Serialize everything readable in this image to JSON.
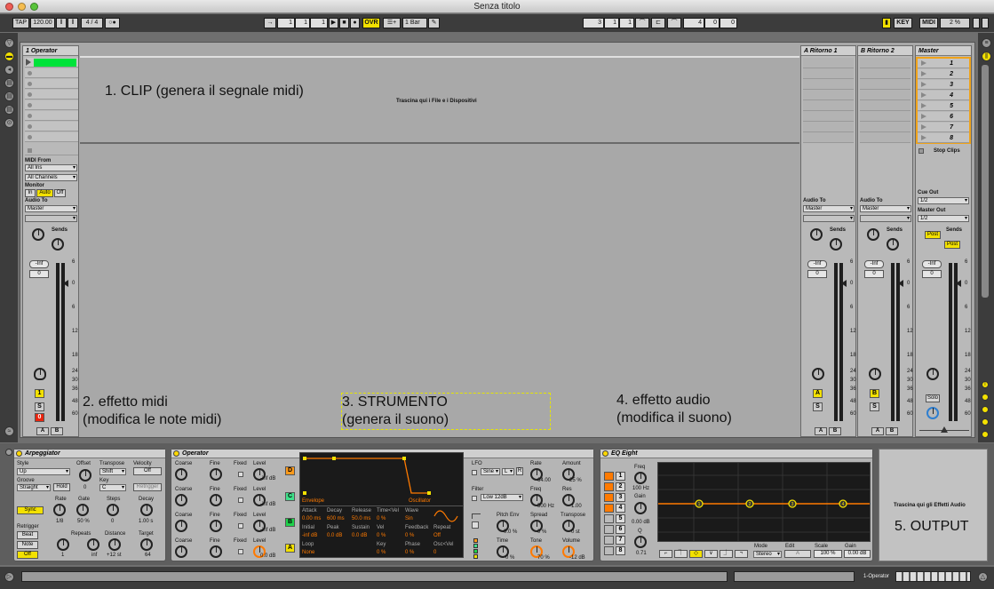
{
  "window": {
    "title": "Senza titolo"
  },
  "transport": {
    "tap": "TAP",
    "tempo": "120.00",
    "sig": "4 / 4",
    "pos_a": "1",
    "pos_b": "1",
    "pos_c": "1",
    "ovr": "OVR",
    "quant": "1 Bar",
    "loop_a": "3",
    "loop_b": "1",
    "loop_c": "1",
    "len_a": "4",
    "len_b": "0",
    "len_c": "0",
    "key": "KEY",
    "midi": "MIDI",
    "cpu": "2 %"
  },
  "tracks": {
    "midi_track": "1 Operator",
    "return_a": "A Ritorno 1",
    "return_b": "B Ritorno 2",
    "master": "Master"
  },
  "session": {
    "drop_hint": "Trascina qui i File e i Dispositivi",
    "scenes": [
      "1",
      "2",
      "3",
      "4",
      "5",
      "6",
      "7",
      "8"
    ],
    "stop_clips": "Stop Clips"
  },
  "io": {
    "midi_from": "MIDI From",
    "all_ins": "All Ins",
    "all_channels": "All Channels",
    "monitor": "Monitor",
    "mon_in": "In",
    "mon_auto": "Auto",
    "mon_off": "Off",
    "audio_to": "Audio To",
    "master": "Master",
    "cue_out": "Cue Out",
    "cue_val": "1/2",
    "master_out": "Master Out",
    "master_out_val": "1/2"
  },
  "mixer": {
    "sends": "Sends",
    "send_a": "A",
    "send_b": "B",
    "vol_inf": "-Inf",
    "vol_zero": "0",
    "post": "Post",
    "track_num": "1",
    "solo": "S",
    "arm": "0",
    "ab_a": "A",
    "ab_b": "B",
    "return_a_btn": "A",
    "return_b_btn": "B",
    "solo_label": "Solo",
    "scale_ticks": [
      "6",
      "0",
      "6",
      "12",
      "18",
      "24",
      "30",
      "36",
      "48",
      "60"
    ]
  },
  "annotations": {
    "clip": "1. CLIP (genera il segnale midi)",
    "midi_fx_1": "2. effetto midi",
    "midi_fx_2": "(modifica le note midi)",
    "instrument_1": "3. STRUMENTO",
    "instrument_2": "(genera il suono)",
    "audio_fx_1": "4. effetto audio",
    "audio_fx_2": "(modifica il suono)",
    "output": "5. OUTPUT"
  },
  "arpeggiator": {
    "title": "Arpeggiator",
    "style": "Style",
    "style_val": "Up",
    "offset": "Offset",
    "offset_val": "0",
    "transpose": "Transpose",
    "transpose_val": "Shift",
    "velocity": "Velocity",
    "vel_off": "Off",
    "groove": "Groove",
    "groove_val": "Straight",
    "hold": "Hold",
    "key": "Key",
    "key_val": "C",
    "retrigger_btn": "Retrigger",
    "sync": "Sync",
    "rate": "Rate",
    "rate_val": "1/8",
    "gate": "Gate",
    "gate_val": "50 %",
    "steps": "Steps",
    "steps_val": "0",
    "decay": "Decay",
    "decay_val": "1.00 s",
    "retrigger": "Retrigger",
    "beat": "Beat",
    "note": "Note",
    "off": "Off",
    "repeats": "Repeats",
    "repeats_val": "1",
    "repeats_inf": "inf",
    "distance": "Distance",
    "distance_val": "+12 st",
    "target": "Target",
    "target_val": "64"
  },
  "operator": {
    "title": "Operator",
    "coarse": "Coarse",
    "fine": "Fine",
    "fixed": "Fixed",
    "level": "Level",
    "level_inf": "-inf dB",
    "level_zero": "0.0 dB",
    "envelope": "Envelope",
    "oscillator": "Oscillator",
    "attack": "Attack",
    "decay": "Decay",
    "release": "Release",
    "timevel": "Time<Vel",
    "wave": "Wave",
    "attack_val": "0.00 ms",
    "decay_val": "600 ms",
    "release_val": "50.0 ms",
    "timevel_val": "0 %",
    "wave_val": "Sin",
    "initial": "Initial",
    "peak": "Peak",
    "sustain": "Sustain",
    "vel": "Vel",
    "feedback": "Feedback",
    "repeat": "Repeat",
    "initial_val": "-inf dB",
    "peak_val": "0.0 dB",
    "sustain_val": "0.0 dB",
    "vel_val": "0 %",
    "feedback_val": "0 %",
    "repeat_val": "Off",
    "loop": "Loop",
    "key": "Key",
    "phase": "Phase",
    "oscvel": "Osc<Vel",
    "loop_val": "None",
    "key_val": "0 %",
    "phase_val": "0 %",
    "oscvel_val": "0",
    "osc_letters": [
      "D",
      "C",
      "B",
      "A"
    ],
    "lfo": "LFO",
    "lfo_wave": "Sine",
    "lfo_l": "L",
    "lfo_r": "R",
    "lfo_rate": "Rate",
    "lfo_rate_val": "64.00",
    "lfo_amount": "Amount",
    "lfo_amount_val": "25 %",
    "filter": "Filter",
    "filter_type": "Low 12dB",
    "freq": "Freq",
    "freq_val": "500 Hz",
    "res": "Res",
    "res_val": "1.00",
    "pitch_env": "Pitch Env",
    "pitch_env_val": "0.0 %",
    "spread": "Spread",
    "spread_val": "0 %",
    "transpose": "Transpose",
    "transpose_val": "0 st",
    "time": "Time",
    "time_val": "0 %",
    "tone": "Tone",
    "tone_val": "70 %",
    "volume": "Volume",
    "volume_val": "-12 dB"
  },
  "eq": {
    "title": "EQ Eight",
    "bands": [
      "1",
      "2",
      "3",
      "4",
      "5",
      "6",
      "7",
      "8"
    ],
    "freq": "Freq",
    "freq_val": "100 Hz",
    "gain": "Gain",
    "gain_val": "0.00 dB",
    "q": "Q",
    "q_val": "0.71",
    "mode": "Mode",
    "mode_val": "Stereo",
    "edit": "Edit",
    "edit_val": "A",
    "scale": "Scale",
    "scale_val": "100 %",
    "gain2": "Gain",
    "gain2_val": "0.00 dB",
    "nodes": [
      "1",
      "2",
      "3",
      "4"
    ]
  },
  "fx_drop": {
    "hint": "Trascina qui gli Effetti Audio"
  },
  "status": {
    "track_label": "1-Operator"
  },
  "colors": {
    "clip_green": "#00e33a",
    "yellow": "#f3e100",
    "orange": "#ff7a00",
    "arm_red": "#e8240e"
  }
}
